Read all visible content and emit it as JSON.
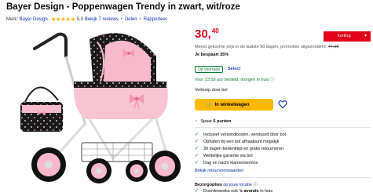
{
  "product": {
    "title": "Bayer Design - Poppenwagen Trendy in zwart, wit/roze",
    "brand_label": "Merk:",
    "brand": "Bayer Design",
    "rating": "5,0",
    "reviews": "Bekijk 7 reviews",
    "share": "Delen",
    "report": "Rapporteer"
  },
  "offer": {
    "price_whole": "30,",
    "price_cents": "40",
    "discount_badge": "korting",
    "lowest_price_note": "Meest gekochte prijs in de laatste 90 dagen, promoties uitgezonderd:",
    "old_price": "47,35",
    "savings": "Je bespaart 35%",
    "stock": "Op voorraad",
    "select": "Select",
    "delivery": "Voor 23:59 uur besteld, morgen in huis",
    "seller": "Verkoop door bol",
    "cart_button": "In winkelwagen",
    "points_prefix": "Spaar",
    "points": "6 punten"
  },
  "usps": [
    "Inclusief verzendkosten, verstuurd door bol",
    "Ophalen bij een bol afhaalpunt mogelijk",
    "30 dagen bedenktijd en gratis retourneren",
    "Wettelijke garantie via bol",
    "Dag en nacht klantenservice"
  ],
  "returns_link": "Bekijk retourvoorwaarden",
  "delivery_options": {
    "label": "Bezorgopties",
    "link": "op jouw locatie",
    "weekday_prefix": "Doordeweeks ook",
    "weekday_bold": "'s avonds",
    "weekday_suffix": "in huis"
  },
  "colors": {
    "price": "#e0001b",
    "cart": "#fcb900",
    "link": "#0a2dae",
    "stock": "#0a7d2c"
  }
}
